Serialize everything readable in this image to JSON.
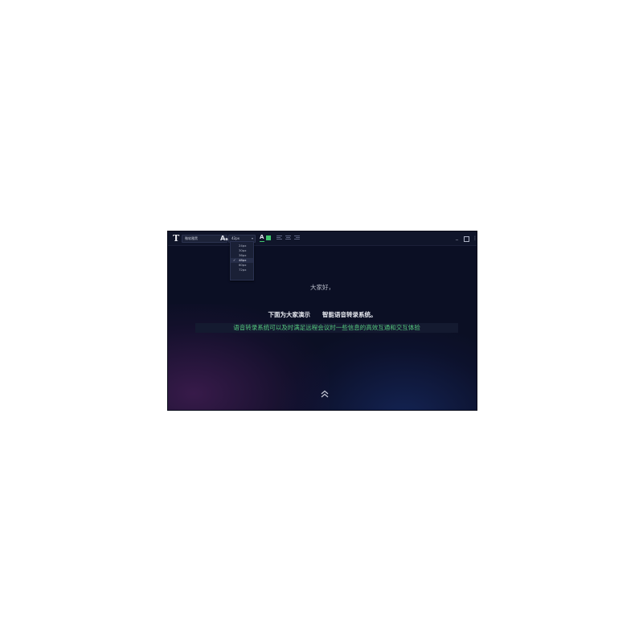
{
  "toolbar": {
    "text_icon": "T",
    "font_select": {
      "value": "微软雅黑"
    },
    "font_size_icon": {
      "big": "A",
      "small": "a"
    },
    "size_select": {
      "value": "42px"
    },
    "color_a": "A",
    "text_color": "#3ec46d",
    "size_options": [
      {
        "label": "24px",
        "selected": false
      },
      {
        "label": "30px",
        "selected": false
      },
      {
        "label": "36px",
        "selected": false
      },
      {
        "label": "48px",
        "selected": true
      },
      {
        "label": "60px",
        "selected": false
      },
      {
        "label": "72px",
        "selected": false
      }
    ],
    "check_mark": "✓",
    "window": {
      "minimize": "_",
      "close": "⋮"
    }
  },
  "caption": {
    "line1": "大家好，",
    "line2": "下面为大家演示　　智能语音转录系统。",
    "line3": "语音转录系统可以及时满足远程会议时一些信息的高效互通和交互体验"
  },
  "icons": {
    "text_tool": "text-tool-icon",
    "font_size": "font-size-icon",
    "text_color": "text-color-icon",
    "align_left": "align-left-icon",
    "align_center": "align-center-icon",
    "align_right": "align-right-icon",
    "scroll_up": "double-chevron-up-icon"
  }
}
